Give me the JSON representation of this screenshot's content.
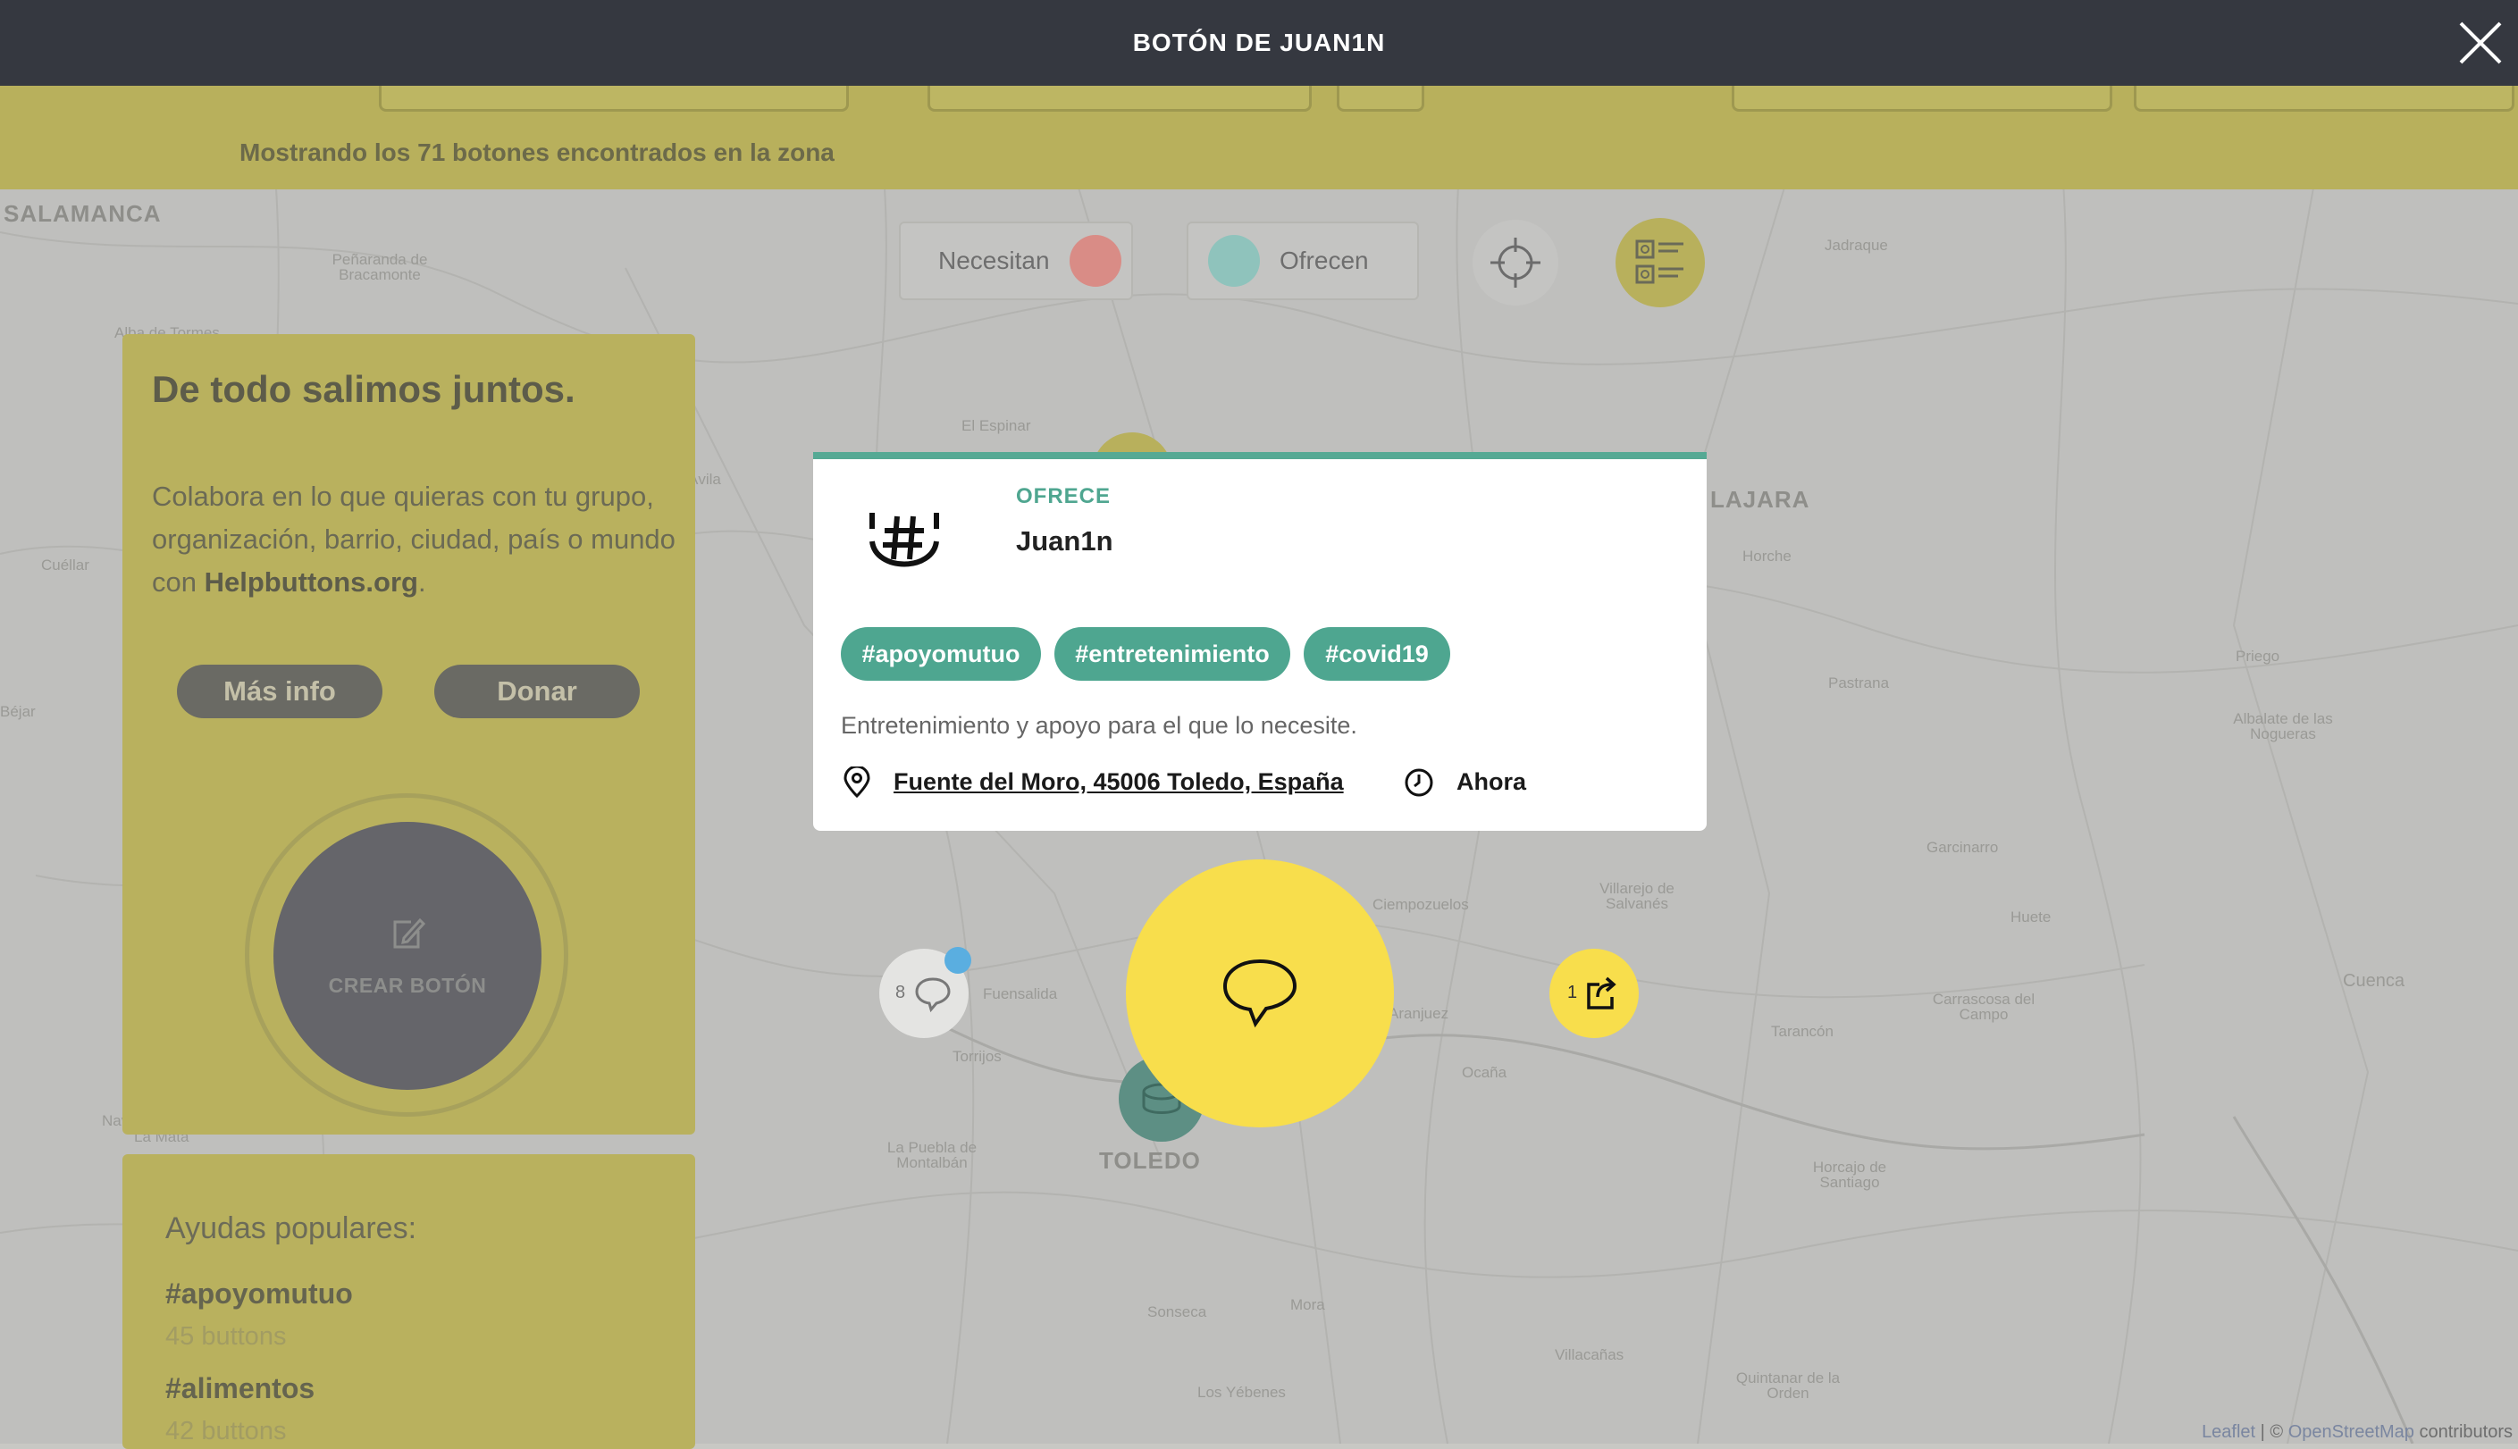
{
  "header": {
    "title": "BOTÓN DE JUAN1N",
    "close_icon": "close-icon"
  },
  "search": {
    "results_text": "Mostrando los 71 botones encontrados en la zona"
  },
  "legend": {
    "need_label": "Necesitan",
    "need_color": "#d98c86",
    "offer_label": "Ofrecen",
    "offer_color": "#8fc3bc"
  },
  "map_controls": {
    "locate_icon": "crosshair-icon",
    "list_icon": "list-view-icon"
  },
  "panel": {
    "title": "De todo salimos juntos.",
    "description_prefix": "Colabora en lo que quieras con tu grupo, organización, barrio, ciudad, país o mundo con ",
    "description_brand": "Helpbuttons.org",
    "description_suffix": ".",
    "more_info_label": "Más info",
    "donate_label": "Donar",
    "create_label": "CREAR BOTÓN",
    "create_icon": "edit-icon"
  },
  "popular": {
    "title": "Ayudas populares:",
    "items": [
      {
        "tag": "#apoyomutuo",
        "count": "45 buttons"
      },
      {
        "tag": "#alimentos",
        "count": "42 buttons"
      }
    ]
  },
  "card": {
    "type": "OFRECE",
    "user": "Juan1n",
    "avatar_icon": "hashtag-smile-icon",
    "tags": [
      "#apoyomutuo",
      "#entretenimiento",
      "#covid19"
    ],
    "description": "Entretenimiento y apoyo para el que lo necesite.",
    "location": "Fuente del Moro, 45006 Toledo, España",
    "location_icon": "map-pin-icon",
    "time": "Ahora",
    "time_icon": "clock-icon",
    "accent_color": "#4ea690"
  },
  "actions": {
    "chat_icon": "chat-bubble-icon",
    "comments_count": "8",
    "comments_icon": "comment-icon",
    "share_count": "1",
    "share_icon": "share-icon"
  },
  "map": {
    "places": [
      "SALAMANCA",
      "Peñaranda de Bracamonte",
      "Alba de Tormes",
      "Jadraque",
      "El Espinar",
      "Ávila",
      "LAJARA",
      "Horche",
      "Cuéllar",
      "Béjar",
      "Priego",
      "Pastrana",
      "Albalate de las Nogueras",
      "Garcinarro",
      "Villarejo de Salvanés",
      "Huete",
      "Ciempozuelos",
      "Fuensalida",
      "Aranjuez",
      "Tarancón",
      "Carrascosa del Campo",
      "Cuenca",
      "Torrijos",
      "Ocaña",
      "La Puebla de Montalbán",
      "TOLEDO",
      "Horcajo de Santiago",
      "Sonseca",
      "Mora",
      "Villacañas",
      "Quintanar de la Orden",
      "Los Yébenes",
      "Navahermosa",
      "La Mata"
    ]
  },
  "attribution": {
    "leaflet": "Leaflet",
    "sep": " | © ",
    "osm": "OpenStreetMap",
    "suffix": " contributors"
  }
}
